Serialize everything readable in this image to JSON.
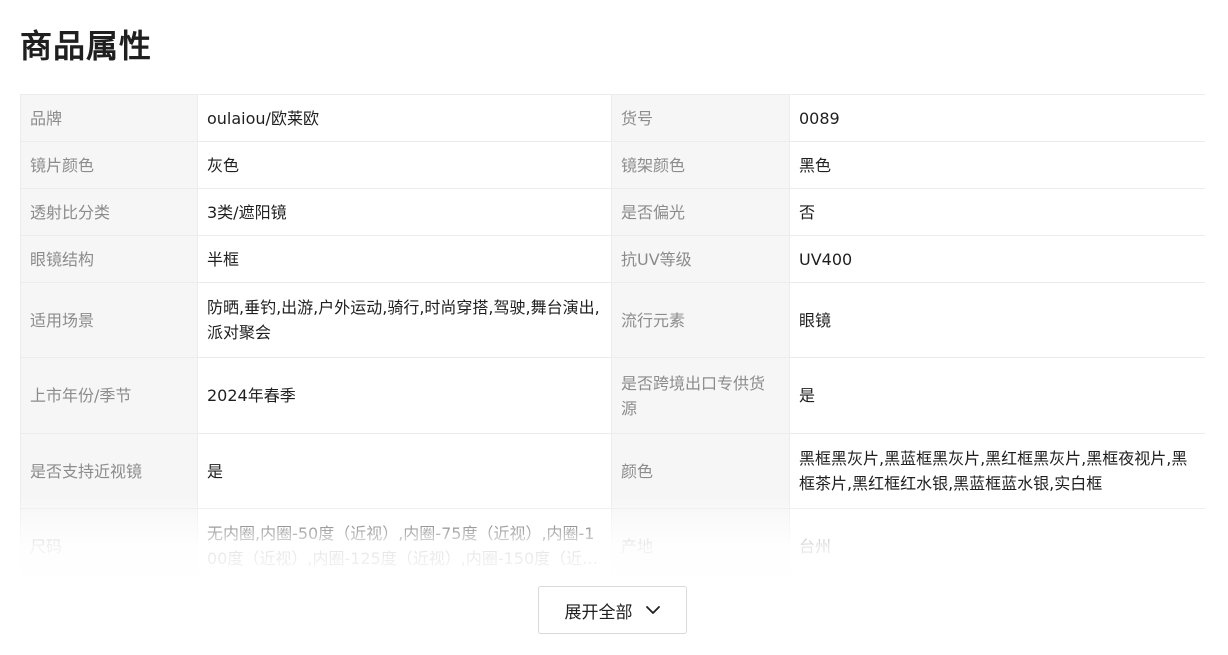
{
  "page": {
    "title": "商品属性"
  },
  "attributes": {
    "rows": [
      {
        "k1": "品牌",
        "v1": "oulaiou/欧莱欧",
        "k2": "货号",
        "v2": "0089"
      },
      {
        "k1": "镜片颜色",
        "v1": "灰色",
        "k2": "镜架颜色",
        "v2": "黑色"
      },
      {
        "k1": "透射比分类",
        "v1": "3类/遮阳镜",
        "k2": "是否偏光",
        "v2": "否"
      },
      {
        "k1": "眼镜结构",
        "v1": "半框",
        "k2": "抗UV等级",
        "v2": "UV400"
      },
      {
        "k1": "适用场景",
        "v1": "防晒,垂钓,出游,户外运动,骑行,时尚穿搭,驾驶,舞台演出,派对聚会",
        "k2": "流行元素",
        "v2": "眼镜"
      },
      {
        "k1": "上市年份/季节",
        "v1": "2024年春季",
        "k2": "是否跨境出口专供货源",
        "v2": "是"
      },
      {
        "k1": "是否支持近视镜",
        "v1": "是",
        "k2": "颜色",
        "v2": "黑框黑灰片,黑蓝框黑灰片,黑红框黑灰片,黑框夜视片,黑框茶片,黑红框红水银,黑蓝框蓝水银,实白框"
      },
      {
        "k1": "尺码",
        "v1": "无内圈,内圈-50度（近视）,内圈-75度（近视）,内圈-100度（近视）,内圈-125度（近视）,内圈-150度（近视）",
        "k2": "产地",
        "v2": "台州"
      }
    ]
  },
  "footer": {
    "expand_label": "展开全部",
    "expand_icon": "chevron-down-icon"
  },
  "colors": {
    "key_background": "#f6f6f6",
    "key_text": "#8c8c8c",
    "value_text": "#1f1f1f",
    "border": "#ececec"
  }
}
